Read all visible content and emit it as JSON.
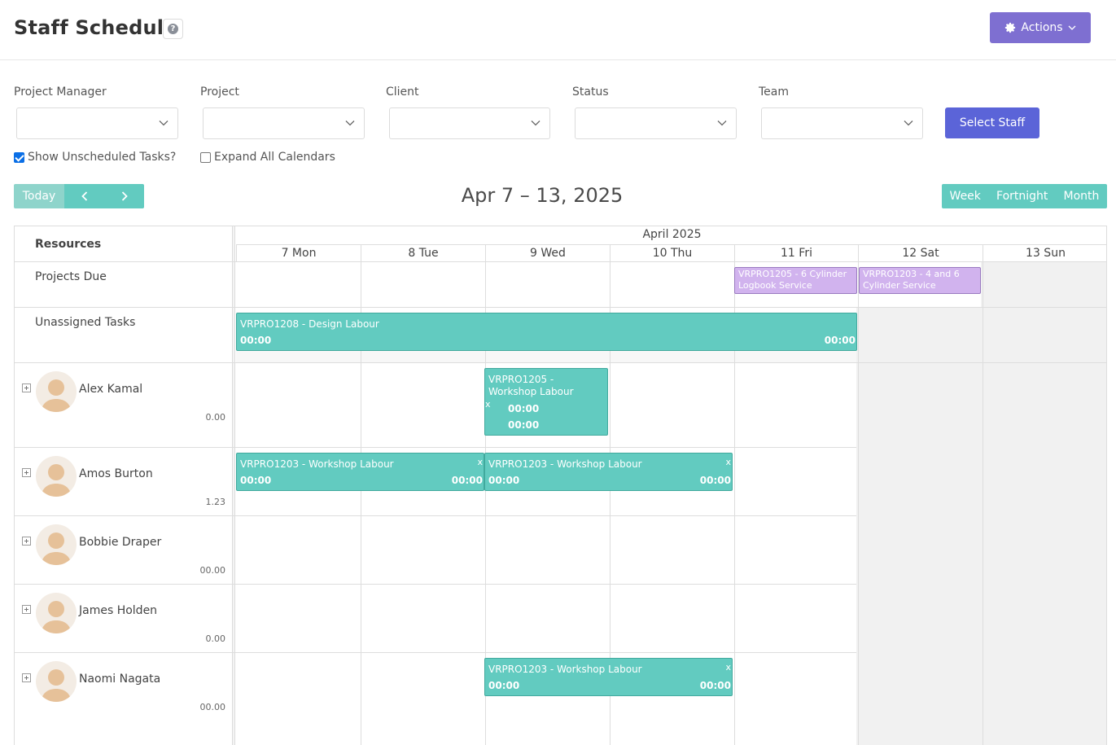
{
  "header": {
    "title": "Staff Schedule",
    "help_icon": "question-circle-icon",
    "actions_label": "Actions"
  },
  "filters": [
    {
      "label": "Project Manager",
      "value": ""
    },
    {
      "label": "Project",
      "value": ""
    },
    {
      "label": "Client",
      "value": ""
    },
    {
      "label": "Status",
      "value": ""
    },
    {
      "label": "Team",
      "value": ""
    }
  ],
  "select_staff_label": "Select Staff",
  "checkboxes": [
    {
      "label": "Show Unscheduled Tasks?",
      "checked": true
    },
    {
      "label": "Expand All Calendars",
      "checked": false
    }
  ],
  "nav": {
    "today_label": "Today",
    "range_title": "Apr 7 – 13, 2025"
  },
  "views": [
    "Week",
    "Fortnight",
    "Month"
  ],
  "calendar": {
    "resources_header": "Resources",
    "month_label": "April 2025",
    "days": [
      "7 Mon",
      "8 Tue",
      "9 Wed",
      "10 Thu",
      "11 Fri",
      "12 Sat",
      "13 Sun"
    ],
    "rows": {
      "projects_due": "Projects Due",
      "unassigned": "Unassigned Tasks"
    },
    "people": [
      {
        "name": "Alex Kamal",
        "hours": "0.00"
      },
      {
        "name": "Amos Burton",
        "hours": "1.23"
      },
      {
        "name": "Bobbie Draper",
        "hours": "00.00"
      },
      {
        "name": "James Holden",
        "hours": "0.00"
      },
      {
        "name": "Naomi Nagata",
        "hours": "00.00"
      }
    ],
    "events": {
      "due1": "VRPRO1205 - 6 Cylinder Logbook Service",
      "due2": "VRPRO1203 - 4 and 6 Cylinder Service",
      "unassigned": {
        "title": "VRPRO1208 - Design Labour",
        "start": "00:00",
        "end": "00:00"
      },
      "alex": {
        "title": "VRPRO1205 - Workshop Labour",
        "mark": "x",
        "start": "00:00",
        "end": "00:00"
      },
      "amos1": {
        "title": "VRPRO1203 - Workshop Labour",
        "mark": "x",
        "start": "00:00",
        "end": "00:00"
      },
      "amos2": {
        "title": "VRPRO1203 - Workshop Labour",
        "mark": "x",
        "start": "00:00",
        "end": "00:00"
      },
      "naomi": {
        "title": "VRPRO1203 - Workshop Labour",
        "mark": "x",
        "start": "00:00",
        "end": "00:00"
      }
    }
  },
  "colors": {
    "teal": "#62cbc0",
    "purple_event": "#d1b3ee",
    "actions": "#7e6fd1",
    "select_staff": "#5b64d8"
  }
}
